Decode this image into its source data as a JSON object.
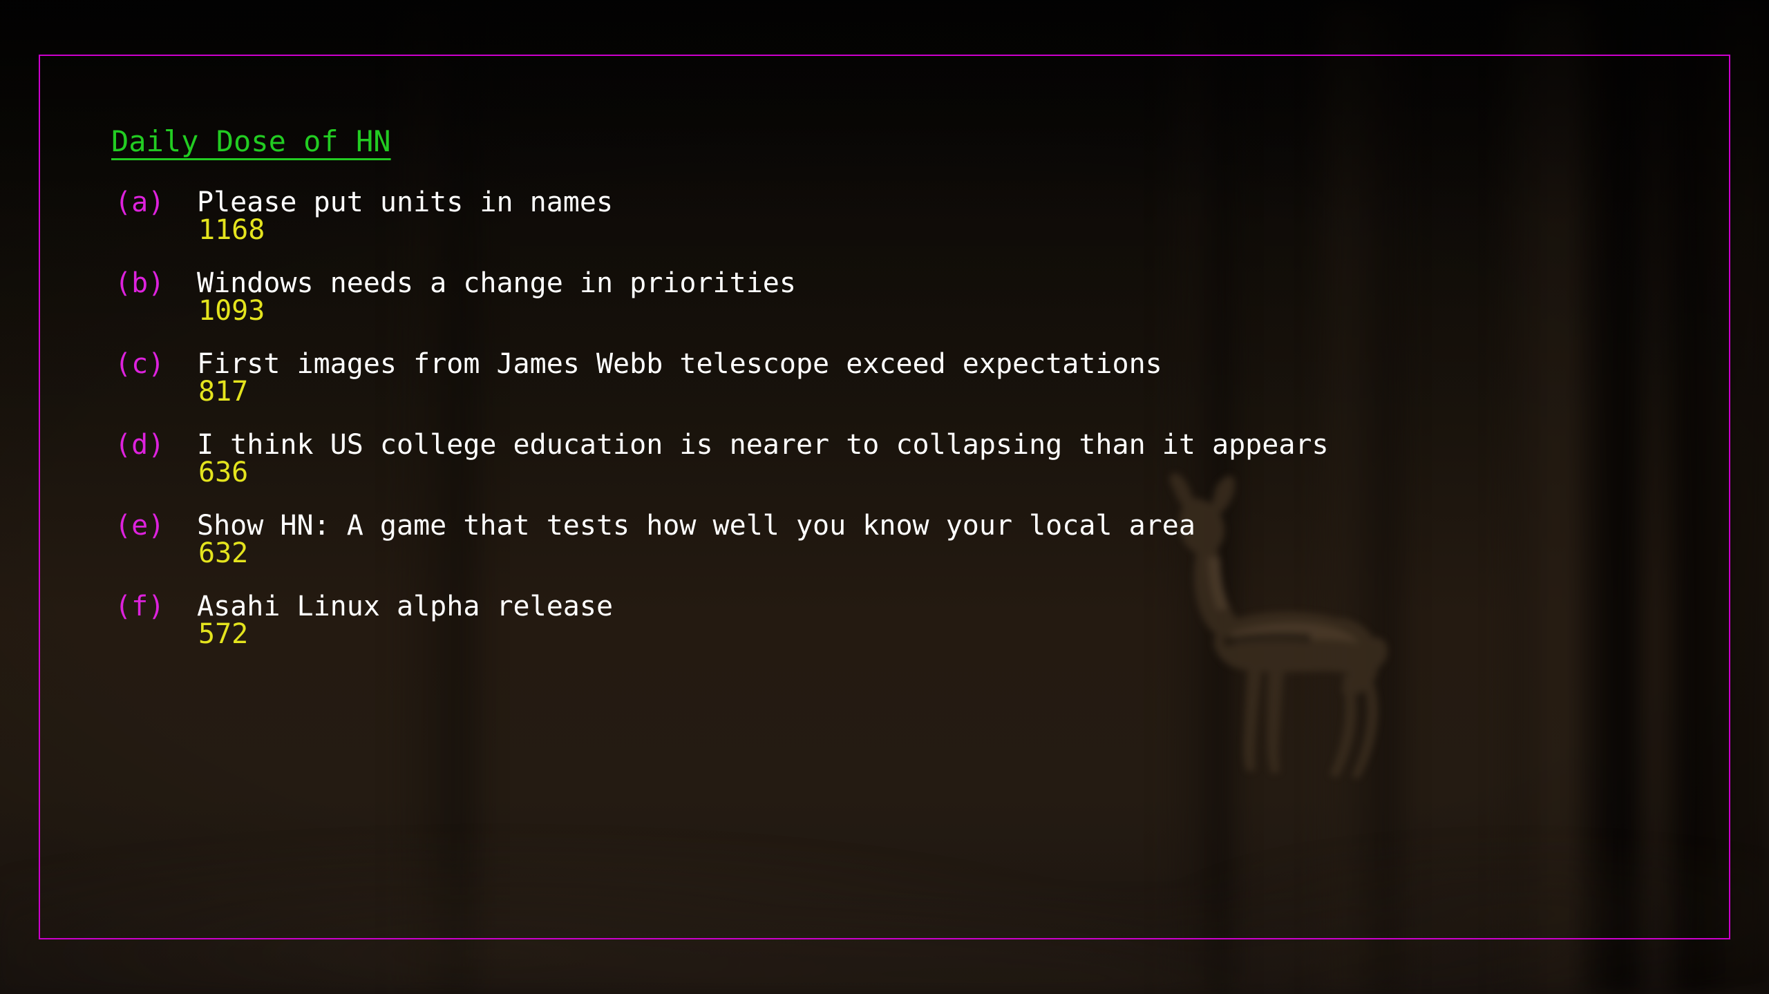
{
  "theme": {
    "title_color": "#22cc22",
    "label_color": "#dd22dd",
    "story_title_color": "#ffffff",
    "score_color": "#e4e41e",
    "border_color": "#cc00cc",
    "background_color": "#0d0a07"
  },
  "panel": {
    "title": "Daily Dose of HN"
  },
  "background": {
    "scene_description": "dark blurred night forest with a deer",
    "subject_icon": "deer-silhouette"
  },
  "stories": [
    {
      "label": "(a)",
      "title": "Please put units in names",
      "score": "1168"
    },
    {
      "label": "(b)",
      "title": "Windows needs a change in priorities",
      "score": "1093"
    },
    {
      "label": "(c)",
      "title": "First images from James Webb telescope exceed expectations",
      "score": "817"
    },
    {
      "label": "(d)",
      "title": "I think US college education is nearer to collapsing than it appears",
      "score": "636"
    },
    {
      "label": "(e)",
      "title": "Show HN: A game that tests how well you know your local area",
      "score": "632"
    },
    {
      "label": "(f)",
      "title": "Asahi Linux alpha release",
      "score": "572"
    }
  ]
}
